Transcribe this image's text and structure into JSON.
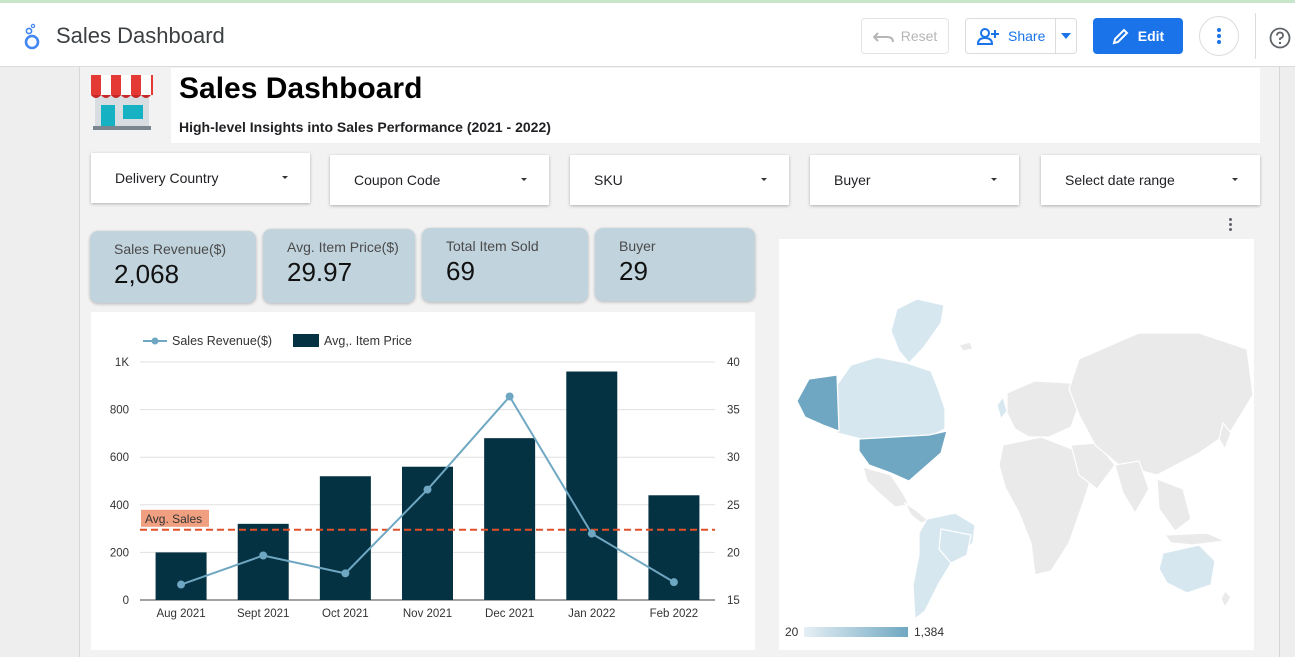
{
  "app": {
    "title": "Sales Dashboard"
  },
  "toolbar": {
    "reset_label": "Reset",
    "share_label": "Share",
    "edit_label": "Edit"
  },
  "dashboard": {
    "title": "Sales Dashboard",
    "subtitle": "High-level Insights into Sales Performance (2021 - 2022)"
  },
  "filters": [
    {
      "label": "Delivery Country"
    },
    {
      "label": "Coupon Code"
    },
    {
      "label": "SKU"
    },
    {
      "label": "Buyer"
    },
    {
      "label": "Select date range"
    }
  ],
  "kpis": [
    {
      "label": "Sales Revenue($)",
      "value": "2,068"
    },
    {
      "label": "Avg. Item Price($)",
      "value": "29.97"
    },
    {
      "label": "Total Item Sold",
      "value": "69"
    },
    {
      "label": "Buyer",
      "value": "29"
    }
  ],
  "colors": {
    "bar": "#053242",
    "line": "#6fa7c2",
    "avg_line": "#e2502a",
    "avg_label_bg": "#f0a080",
    "kpi_bg": "#c1d3dd",
    "map_high": "#6fa7c2",
    "map_low": "#d7e7f0",
    "map_none": "#eaeaea",
    "accent": "#1a73e8"
  },
  "icons": [
    "looker-studio-icon",
    "undo-icon",
    "person-add-icon",
    "edit-pencil-icon",
    "more-vert-icon",
    "help-icon",
    "storefront-icon"
  ],
  "chart_data": {
    "type": "bar",
    "categories": [
      "Aug 2021",
      "Sept 2021",
      "Oct 2021",
      "Nov 2021",
      "Dec 2021",
      "Jan 2022",
      "Feb 2022"
    ],
    "series": [
      {
        "name": "Sales Revenue($)",
        "type": "line",
        "axis": "left",
        "values": [
          65,
          187,
          112,
          464,
          855,
          279,
          75
        ]
      },
      {
        "name": "Avg,. Item Price",
        "type": "bar",
        "axis": "right",
        "values": [
          20,
          23,
          28,
          29,
          32,
          39,
          26
        ]
      }
    ],
    "reference_line": {
      "label": "Avg. Sales",
      "axis": "left",
      "value": 295
    },
    "y_left": {
      "ylim": [
        0,
        1000
      ],
      "ticks": [
        "0",
        "200",
        "400",
        "600",
        "800",
        "1K"
      ]
    },
    "y_right": {
      "ylim": [
        15,
        40
      ],
      "ticks": [
        "15",
        "20",
        "25",
        "30",
        "35",
        "40"
      ]
    },
    "legend": "top-left",
    "grid": true
  },
  "map": {
    "type": "geo",
    "legend_min": "20",
    "legend_max": "1,384",
    "highlighted": [
      "United States",
      "Canada",
      "Australia",
      "Brazil",
      "United Kingdom"
    ]
  }
}
